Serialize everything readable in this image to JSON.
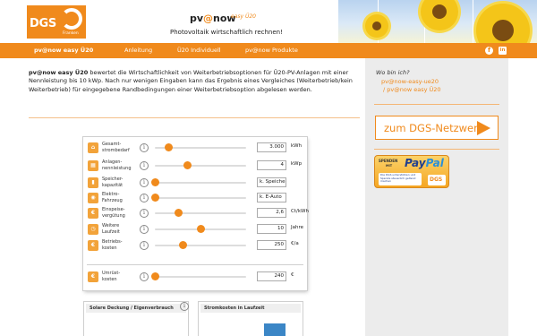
{
  "logo": {
    "text": "DGS",
    "subtext": "Franken"
  },
  "brand": {
    "pv": "pv",
    "at": "@",
    "now": "now",
    "sup": "easy Ü20",
    "tagline": "Photovoltaik wirtschaftlich rechnen!"
  },
  "nav": {
    "items": [
      {
        "label": "pv@now easy Ü20",
        "active": true
      },
      {
        "label": "Anleitung",
        "active": false
      },
      {
        "label": "Ü20 Individuell",
        "active": false
      },
      {
        "label": "pv@now Produkte",
        "active": false
      }
    ],
    "social": {
      "facebook": "f",
      "linkedin": "in"
    }
  },
  "intro": {
    "bold": "pv@now easy Ü20",
    "text": " bewertet die Wirtschaftlichkeit von Weiterbetriebsoptionen für Ü20-PV-Anlagen mit einer Nennleistung bis 10 kWp. Nach nur wenigen Eingaben kann das Ergebnis eines Vergleiches (Weiterbetrieb/kein Weiterbetrieb) für eingegebene Randbedingungen einer Weiterbetriebsoption abgelesen werden."
  },
  "calculator": {
    "rows": [
      {
        "label": "Gesamt-\nstrombedarf",
        "value": "3.000",
        "unit": "kWh",
        "icon": "house-icon",
        "glyph": "⌂",
        "level": 0.15
      },
      {
        "label": "Anlagen-\nnennleistung",
        "value": "4",
        "unit": "kWp",
        "icon": "solar-panel-icon",
        "glyph": "▦",
        "level": 0.35
      },
      {
        "label": "Speicher-\nkapazität",
        "value": "k. Speiche",
        "unit": "",
        "icon": "battery-icon",
        "glyph": "▮",
        "level": 0.0
      },
      {
        "label": "Elektro-\nFahrzeug",
        "value": "k. E-Auto",
        "unit": "",
        "icon": "car-icon",
        "glyph": "◉",
        "level": 0.0
      },
      {
        "label": "Einspeise-\nvergütung",
        "value": "2,6",
        "unit": "Ct/kWh",
        "icon": "euro-icon",
        "glyph": "€",
        "level": 0.25
      },
      {
        "label": "Weitere\nLaufzeit",
        "value": "10",
        "unit": "Jahre",
        "icon": "clock-icon",
        "glyph": "◷",
        "level": 0.5
      },
      {
        "label": "Betriebs-\nkosten",
        "value": "250",
        "unit": "€/a",
        "icon": "wrench-euro-icon",
        "glyph": "€",
        "level": 0.3
      }
    ],
    "extra": {
      "label": "Umrüst-\nkosten",
      "value": "240",
      "unit": "€",
      "icon": "euro-coin-icon",
      "glyph": "€",
      "level": 0.0
    }
  },
  "results": [
    {
      "title": "Solare Deckung / Eigenverbrauch"
    },
    {
      "title": "Stromkosten in Laufzeit"
    }
  ],
  "sidebar": {
    "title": "Wo bin ich?",
    "links": [
      "pv@now-easy-ue20",
      "/ pv@now easy Ü20"
    ],
    "dgs_button": "zum DGS-Netzwerk",
    "paypal": {
      "spenden": "SPENDEN",
      "mit": "MIT",
      "pay": "Pay",
      "pal": "Pal",
      "note": "Die DGS unterstützen und Spende steuerlich geltend machen",
      "dgs": "DGS"
    }
  },
  "colors": {
    "accent": "#f08a1c",
    "sidebar_bg": "#ececec",
    "bar": "#3b86c6"
  },
  "info_glyph": "i"
}
